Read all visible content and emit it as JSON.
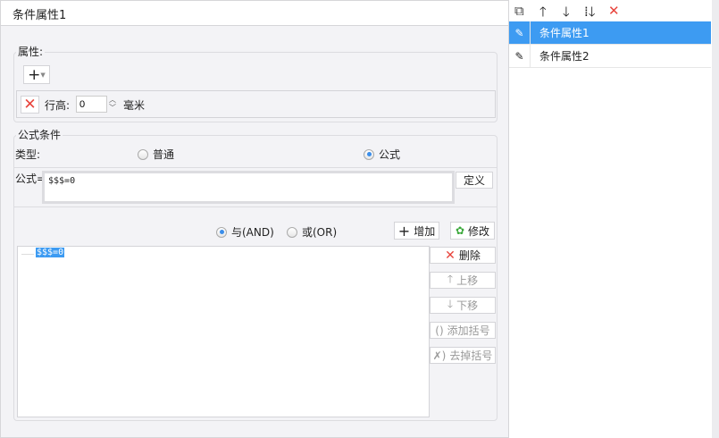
{
  "title": "条件属性1",
  "properties": {
    "legend": "属性:",
    "add_icon": "plus-dropdown-icon",
    "row_height_label": "行高:",
    "row_height_value": "0",
    "unit": "毫米"
  },
  "formula_condition": {
    "legend": "公式条件",
    "type_label": "类型:",
    "type_options": [
      {
        "label": "普通",
        "checked": false
      },
      {
        "label": "公式",
        "checked": true
      }
    ],
    "formula_label": "公式=",
    "formula_value": "$$$=0",
    "define_button": "定义",
    "logic_options": [
      {
        "label": "与(AND)",
        "checked": true
      },
      {
        "label": "或(OR)",
        "checked": false
      }
    ],
    "add_button": "增加",
    "modify_button": "修改",
    "conditions": [
      "$$$=0"
    ],
    "delete_button": "删除",
    "move_up_button": "上移",
    "move_down_button": "下移",
    "add_bracket_button": "添加括号",
    "remove_bracket_button": "去掉括号"
  },
  "conditions_list": {
    "items": [
      {
        "label": "条件属性1",
        "selected": true
      },
      {
        "label": "条件属性2",
        "selected": false
      }
    ]
  },
  "colors": {
    "accent": "#3d9bf2",
    "delete": "#e8433b"
  }
}
